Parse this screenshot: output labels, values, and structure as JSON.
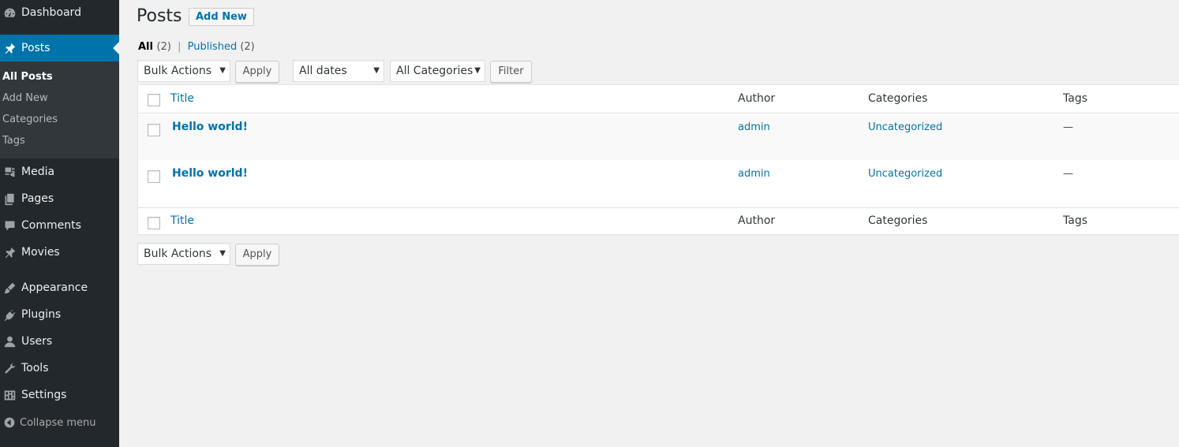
{
  "sidebar": {
    "items": [
      {
        "label": "Dashboard",
        "icon": "dashboard-icon"
      },
      {
        "label": "Posts",
        "icon": "pushpin-icon"
      },
      {
        "label": "Media",
        "icon": "media-icon"
      },
      {
        "label": "Pages",
        "icon": "pages-icon"
      },
      {
        "label": "Comments",
        "icon": "comment-icon"
      },
      {
        "label": "Movies",
        "icon": "pushpin-icon"
      },
      {
        "label": "Appearance",
        "icon": "paintbrush-icon"
      },
      {
        "label": "Plugins",
        "icon": "plug-icon"
      },
      {
        "label": "Users",
        "icon": "user-icon"
      },
      {
        "label": "Tools",
        "icon": "wrench-icon"
      },
      {
        "label": "Settings",
        "icon": "settings-icon"
      }
    ],
    "submenu": [
      "All Posts",
      "Add New",
      "Categories",
      "Tags"
    ],
    "collapse_label": "Collapse menu",
    "active_color": "#0073aa",
    "background_color": "#23282d"
  },
  "header": {
    "title": "Posts",
    "add_new_label": "Add New"
  },
  "views": {
    "all_label": "All",
    "all_count": "(2)",
    "separator": "|",
    "published_label": "Published",
    "published_count": "(2)"
  },
  "filters": {
    "bulk_actions": "Bulk Actions",
    "apply_label": "Apply",
    "dates": "All dates",
    "categories": "All Categories",
    "filter_label": "Filter"
  },
  "table": {
    "columns": [
      "Title",
      "Author",
      "Categories",
      "Tags"
    ],
    "rows": [
      {
        "title": "Hello world!",
        "author": "admin",
        "categories": "Uncategorized",
        "tags": "—"
      },
      {
        "title": "Hello world!",
        "author": "admin",
        "categories": "Uncategorized",
        "tags": "—"
      }
    ]
  },
  "bottom": {
    "bulk_actions": "Bulk Actions",
    "apply_label": "Apply"
  }
}
